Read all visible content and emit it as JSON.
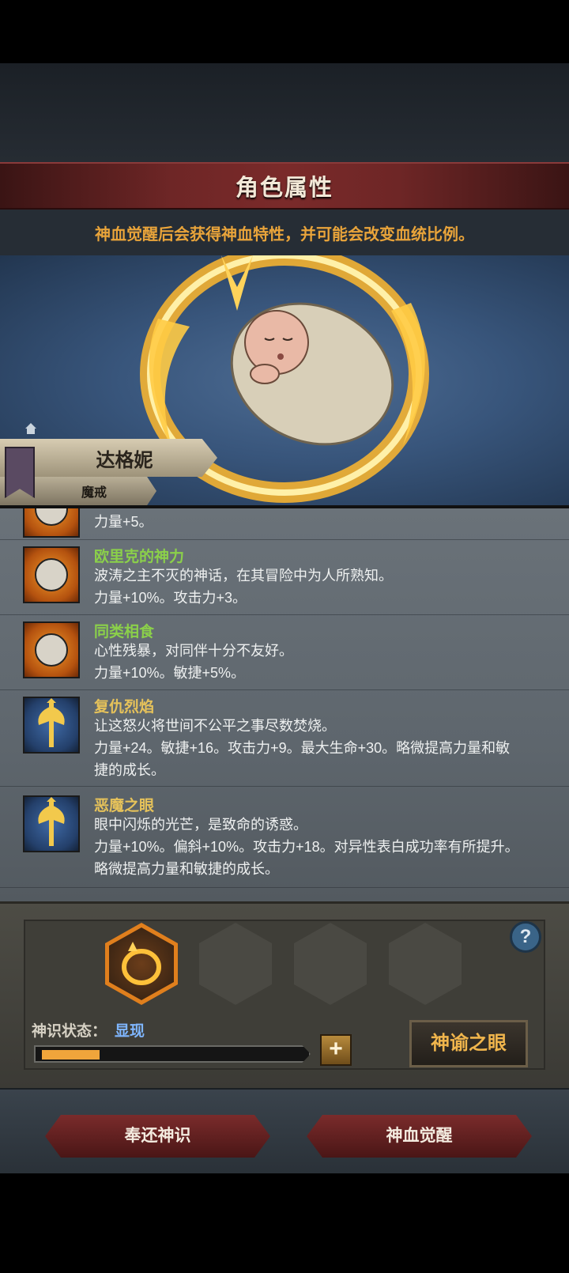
{
  "header": {
    "title": "角色属性"
  },
  "notice": {
    "text": "神血觉醒后会获得神血特性，并可能会改变血统比例。"
  },
  "character": {
    "name": "达格妮",
    "subtitle": "魔戒"
  },
  "traits": [
    {
      "name": "",
      "desc": "",
      "stats": "力量+5。",
      "icon": "sun-face-icon"
    },
    {
      "name": "欧里克的神力",
      "desc": "波涛之主不灭的神话，在其冒险中为人所熟知。",
      "stats": "力量+10%。攻击力+3。",
      "icon": "sun-face-icon"
    },
    {
      "name": "同类相食",
      "desc": "心性残暴，对同伴十分不友好。",
      "stats": "力量+10%。敏捷+5%。",
      "icon": "sun-face-icon"
    },
    {
      "name": "复仇烈焰",
      "desc": "让这怒火将世间不公平之事尽数焚烧。",
      "stats": "力量+24。敏捷+16。攻击力+9。最大生命+30。略微提高力量和敏",
      "stats2": "捷的成长。",
      "icon": "axe-icon"
    },
    {
      "name": "恶魔之眼",
      "desc": "眼中闪烁的光芒，是致命的诱惑。",
      "stats": "力量+10%。偏斜+10%。攻击力+18。对异性表白成功率有所提升。",
      "stats2": "略微提高力量和敏捷的成长。",
      "icon": "axe-icon"
    }
  ],
  "divine": {
    "status_label": "神识状态：",
    "status_value": "显现",
    "progress": 0.22,
    "plus_label": "+",
    "help_label": "?",
    "oracle_label": "神谕之眼"
  },
  "actions": {
    "return_label": "奉还神识",
    "awaken_label": "神血觉醒"
  },
  "colors": {
    "accent_orange": "#e9a43a",
    "trait_green": "#8bd04a",
    "status_blue": "#7fb6ff"
  }
}
